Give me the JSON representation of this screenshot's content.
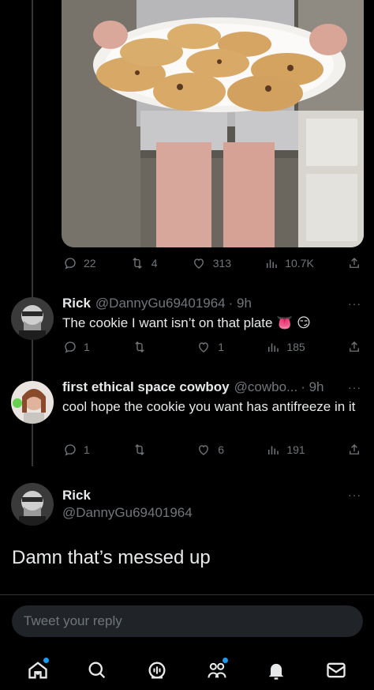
{
  "main_tweet": {
    "stats": {
      "replies": "22",
      "retweets": "4",
      "likes": "313",
      "views": "10.7K"
    }
  },
  "replies": [
    {
      "name": "Rick",
      "handle": "@DannyGu69401964",
      "time": "· 9h",
      "text": "The cookie I want isn’t on that plate 👅 😏",
      "stats": {
        "replies": "1",
        "retweets": "",
        "likes": "1",
        "views": "185"
      }
    },
    {
      "name": "first ethical space cowboy",
      "handle": "@cowbo...",
      "time": "· 9h",
      "text": "cool hope the cookie you want has antifreeze in it",
      "stats": {
        "replies": "1",
        "retweets": "",
        "likes": "6",
        "views": "191"
      }
    }
  ],
  "focused_tweet": {
    "name": "Rick",
    "handle": "@DannyGu69401964",
    "text": "Damn that’s messed up"
  },
  "reply_input": {
    "placeholder": "Tweet your reply"
  },
  "more_label": "···",
  "colors": {
    "accent": "#1d9bf0",
    "muted": "#71767b",
    "background": "#000000"
  },
  "tabbar": [
    {
      "icon": "home-icon",
      "notification": true
    },
    {
      "icon": "search-icon",
      "notification": false
    },
    {
      "icon": "spaces-icon",
      "notification": false
    },
    {
      "icon": "communities-icon",
      "notification": true
    },
    {
      "icon": "notifications-bell-icon",
      "notification": false
    },
    {
      "icon": "messages-icon",
      "notification": false
    }
  ]
}
